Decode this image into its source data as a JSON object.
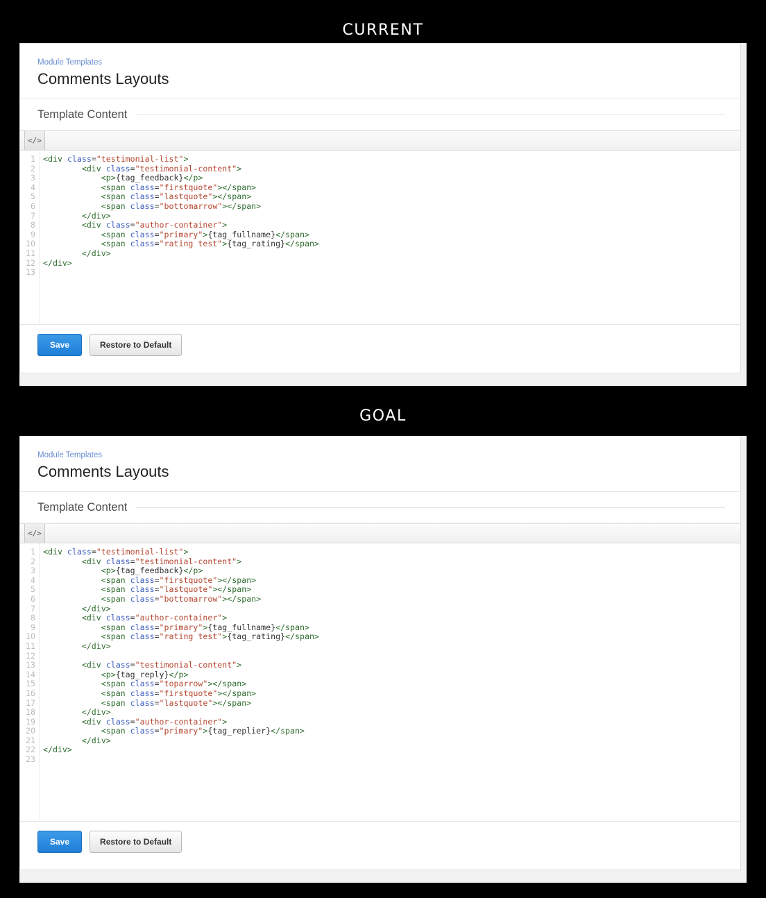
{
  "sections": [
    {
      "caption": "CURRENT"
    },
    {
      "caption": "GOAL"
    }
  ],
  "app": {
    "breadcrumb": "Module Templates",
    "page_title": "Comments Layouts",
    "section_title": "Template Content",
    "editor_toolbar": {
      "code_view_icon": "</>"
    },
    "buttons": {
      "save_label": "Save",
      "restore_label": "Restore to Default"
    }
  },
  "colors": {
    "breadcrumb_link": "#6a8fd0",
    "primary_button": "#1f7fd6",
    "tag": "#2d6b2d",
    "attribute": "#3b5bbf",
    "string": "#b5452f",
    "gutter_text": "#bcbcbc",
    "backdrop": "#000000"
  },
  "current_editor": {
    "line_count": 13,
    "line_numbers": [
      1,
      2,
      3,
      4,
      5,
      6,
      7,
      8,
      9,
      10,
      11,
      12,
      13
    ],
    "lines": [
      [
        {
          "c": "t",
          "v": "<div "
        },
        {
          "c": "a",
          "v": "class"
        },
        {
          "c": "eq",
          "v": "="
        },
        {
          "c": "s",
          "v": "\"testimonial-list\""
        },
        {
          "c": "t",
          "v": ">"
        }
      ],
      [
        {
          "c": "p",
          "v": "        "
        },
        {
          "c": "t",
          "v": "<div "
        },
        {
          "c": "a",
          "v": "class"
        },
        {
          "c": "eq",
          "v": "="
        },
        {
          "c": "s",
          "v": "\"testimonial-content\""
        },
        {
          "c": "t",
          "v": ">"
        }
      ],
      [
        {
          "c": "p",
          "v": "            "
        },
        {
          "c": "t",
          "v": "<p>"
        },
        {
          "c": "p",
          "v": "{tag_feedback}"
        },
        {
          "c": "t",
          "v": "</p>"
        }
      ],
      [
        {
          "c": "p",
          "v": "            "
        },
        {
          "c": "t",
          "v": "<span "
        },
        {
          "c": "a",
          "v": "class"
        },
        {
          "c": "eq",
          "v": "="
        },
        {
          "c": "s",
          "v": "\"firstquote\""
        },
        {
          "c": "t",
          "v": "></span>"
        }
      ],
      [
        {
          "c": "p",
          "v": "            "
        },
        {
          "c": "t",
          "v": "<span "
        },
        {
          "c": "a",
          "v": "class"
        },
        {
          "c": "eq",
          "v": "="
        },
        {
          "c": "s",
          "v": "\"lastquote\""
        },
        {
          "c": "t",
          "v": "></span>"
        }
      ],
      [
        {
          "c": "p",
          "v": "            "
        },
        {
          "c": "t",
          "v": "<span "
        },
        {
          "c": "a",
          "v": "class"
        },
        {
          "c": "eq",
          "v": "="
        },
        {
          "c": "s",
          "v": "\"bottomarrow\""
        },
        {
          "c": "t",
          "v": "></span>"
        }
      ],
      [
        {
          "c": "p",
          "v": "        "
        },
        {
          "c": "t",
          "v": "</div>"
        }
      ],
      [
        {
          "c": "p",
          "v": "        "
        },
        {
          "c": "t",
          "v": "<div "
        },
        {
          "c": "a",
          "v": "class"
        },
        {
          "c": "eq",
          "v": "="
        },
        {
          "c": "s",
          "v": "\"author-container\""
        },
        {
          "c": "t",
          "v": ">"
        }
      ],
      [
        {
          "c": "p",
          "v": "            "
        },
        {
          "c": "t",
          "v": "<span "
        },
        {
          "c": "a",
          "v": "class"
        },
        {
          "c": "eq",
          "v": "="
        },
        {
          "c": "s",
          "v": "\"primary\""
        },
        {
          "c": "t",
          "v": ">"
        },
        {
          "c": "p",
          "v": "{tag_fullname}"
        },
        {
          "c": "t",
          "v": "</span>"
        }
      ],
      [
        {
          "c": "p",
          "v": "            "
        },
        {
          "c": "t",
          "v": "<span "
        },
        {
          "c": "a",
          "v": "class"
        },
        {
          "c": "eq",
          "v": "="
        },
        {
          "c": "s",
          "v": "\"rating test\""
        },
        {
          "c": "t",
          "v": ">"
        },
        {
          "c": "p",
          "v": "{tag_rating}"
        },
        {
          "c": "t",
          "v": "</span>"
        }
      ],
      [
        {
          "c": "p",
          "v": "        "
        },
        {
          "c": "t",
          "v": "</div>"
        }
      ],
      [
        {
          "c": "t",
          "v": "</div>"
        }
      ],
      []
    ]
  },
  "goal_editor": {
    "line_count": 23,
    "line_numbers": [
      1,
      2,
      3,
      4,
      5,
      6,
      7,
      8,
      9,
      10,
      11,
      12,
      13,
      14,
      15,
      16,
      17,
      18,
      19,
      20,
      21,
      22,
      23
    ],
    "lines": [
      [
        {
          "c": "t",
          "v": "<div "
        },
        {
          "c": "a",
          "v": "class"
        },
        {
          "c": "eq",
          "v": "="
        },
        {
          "c": "s",
          "v": "\"testimonial-list\""
        },
        {
          "c": "t",
          "v": ">"
        }
      ],
      [
        {
          "c": "p",
          "v": "        "
        },
        {
          "c": "t",
          "v": "<div "
        },
        {
          "c": "a",
          "v": "class"
        },
        {
          "c": "eq",
          "v": "="
        },
        {
          "c": "s",
          "v": "\"testimonial-content\""
        },
        {
          "c": "t",
          "v": ">"
        }
      ],
      [
        {
          "c": "p",
          "v": "            "
        },
        {
          "c": "t",
          "v": "<p>"
        },
        {
          "c": "p",
          "v": "{tag_feedback}"
        },
        {
          "c": "t",
          "v": "</p>"
        }
      ],
      [
        {
          "c": "p",
          "v": "            "
        },
        {
          "c": "t",
          "v": "<span "
        },
        {
          "c": "a",
          "v": "class"
        },
        {
          "c": "eq",
          "v": "="
        },
        {
          "c": "s",
          "v": "\"firstquote\""
        },
        {
          "c": "t",
          "v": "></span>"
        }
      ],
      [
        {
          "c": "p",
          "v": "            "
        },
        {
          "c": "t",
          "v": "<span "
        },
        {
          "c": "a",
          "v": "class"
        },
        {
          "c": "eq",
          "v": "="
        },
        {
          "c": "s",
          "v": "\"lastquote\""
        },
        {
          "c": "t",
          "v": "></span>"
        }
      ],
      [
        {
          "c": "p",
          "v": "            "
        },
        {
          "c": "t",
          "v": "<span "
        },
        {
          "c": "a",
          "v": "class"
        },
        {
          "c": "eq",
          "v": "="
        },
        {
          "c": "s",
          "v": "\"bottomarrow\""
        },
        {
          "c": "t",
          "v": "></span>"
        }
      ],
      [
        {
          "c": "p",
          "v": "        "
        },
        {
          "c": "t",
          "v": "</div>"
        }
      ],
      [
        {
          "c": "p",
          "v": "        "
        },
        {
          "c": "t",
          "v": "<div "
        },
        {
          "c": "a",
          "v": "class"
        },
        {
          "c": "eq",
          "v": "="
        },
        {
          "c": "s",
          "v": "\"author-container\""
        },
        {
          "c": "t",
          "v": ">"
        }
      ],
      [
        {
          "c": "p",
          "v": "            "
        },
        {
          "c": "t",
          "v": "<span "
        },
        {
          "c": "a",
          "v": "class"
        },
        {
          "c": "eq",
          "v": "="
        },
        {
          "c": "s",
          "v": "\"primary\""
        },
        {
          "c": "t",
          "v": ">"
        },
        {
          "c": "p",
          "v": "{tag_fullname}"
        },
        {
          "c": "t",
          "v": "</span>"
        }
      ],
      [
        {
          "c": "p",
          "v": "            "
        },
        {
          "c": "t",
          "v": "<span "
        },
        {
          "c": "a",
          "v": "class"
        },
        {
          "c": "eq",
          "v": "="
        },
        {
          "c": "s",
          "v": "\"rating test\""
        },
        {
          "c": "t",
          "v": ">"
        },
        {
          "c": "p",
          "v": "{tag_rating}"
        },
        {
          "c": "t",
          "v": "</span>"
        }
      ],
      [
        {
          "c": "p",
          "v": "        "
        },
        {
          "c": "t",
          "v": "</div>"
        }
      ],
      [],
      [
        {
          "c": "p",
          "v": "        "
        },
        {
          "c": "t",
          "v": "<div "
        },
        {
          "c": "a",
          "v": "class"
        },
        {
          "c": "eq",
          "v": "="
        },
        {
          "c": "s",
          "v": "\"testimonial-content\""
        },
        {
          "c": "t",
          "v": ">"
        }
      ],
      [
        {
          "c": "p",
          "v": "            "
        },
        {
          "c": "t",
          "v": "<p>"
        },
        {
          "c": "p",
          "v": "{tag_reply}"
        },
        {
          "c": "t",
          "v": "</p>"
        }
      ],
      [
        {
          "c": "p",
          "v": "            "
        },
        {
          "c": "t",
          "v": "<span "
        },
        {
          "c": "a",
          "v": "class"
        },
        {
          "c": "eq",
          "v": "="
        },
        {
          "c": "s",
          "v": "\"toparrow\""
        },
        {
          "c": "t",
          "v": "></span>"
        }
      ],
      [
        {
          "c": "p",
          "v": "            "
        },
        {
          "c": "t",
          "v": "<span "
        },
        {
          "c": "a",
          "v": "class"
        },
        {
          "c": "eq",
          "v": "="
        },
        {
          "c": "s",
          "v": "\"firstquote\""
        },
        {
          "c": "t",
          "v": "></span>"
        }
      ],
      [
        {
          "c": "p",
          "v": "            "
        },
        {
          "c": "t",
          "v": "<span "
        },
        {
          "c": "a",
          "v": "class"
        },
        {
          "c": "eq",
          "v": "="
        },
        {
          "c": "s",
          "v": "\"lastquote\""
        },
        {
          "c": "t",
          "v": "></span>"
        }
      ],
      [
        {
          "c": "p",
          "v": "        "
        },
        {
          "c": "t",
          "v": "</div>"
        }
      ],
      [
        {
          "c": "p",
          "v": "        "
        },
        {
          "c": "t",
          "v": "<div "
        },
        {
          "c": "a",
          "v": "class"
        },
        {
          "c": "eq",
          "v": "="
        },
        {
          "c": "s",
          "v": "\"author-container\""
        },
        {
          "c": "t",
          "v": ">"
        }
      ],
      [
        {
          "c": "p",
          "v": "            "
        },
        {
          "c": "t",
          "v": "<span "
        },
        {
          "c": "a",
          "v": "class"
        },
        {
          "c": "eq",
          "v": "="
        },
        {
          "c": "s",
          "v": "\"primary\""
        },
        {
          "c": "t",
          "v": ">"
        },
        {
          "c": "p",
          "v": "{tag_replier}"
        },
        {
          "c": "t",
          "v": "</span>"
        }
      ],
      [
        {
          "c": "p",
          "v": "        "
        },
        {
          "c": "t",
          "v": "</div>"
        }
      ],
      [
        {
          "c": "t",
          "v": "</div>"
        }
      ],
      []
    ]
  }
}
